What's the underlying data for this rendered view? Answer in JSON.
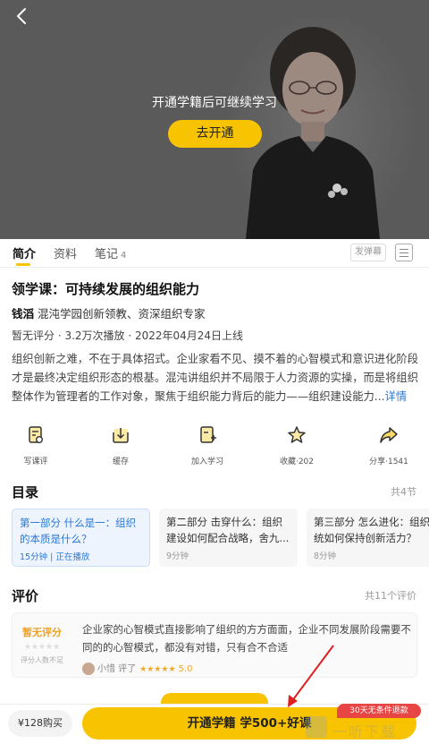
{
  "player": {
    "prompt": "开通学籍后可继续学习",
    "open_button": "去开通"
  },
  "tabs": [
    {
      "label": "简介",
      "active": true
    },
    {
      "label": "资料"
    },
    {
      "label": "笔记",
      "count": "4"
    }
  ],
  "danmu_button": "发弹幕",
  "course": {
    "title": "领学课：可持续发展的组织能力",
    "author": "钱滔",
    "author_desc": "混沌学园创新领教、资深组织专家",
    "stats": "暂无评分 · 3.2万次播放 · 2022年04月24日上线",
    "description": "组织创新之难，不在于具体招式。企业家看不见、摸不着的心智模式和意识进化阶段才是最终决定组织形态的根基。混沌讲组织并不局限于人力资源的实操，而是将组织整体作为管理者的工作对象，聚焦于组织能力背后的能力——组织建设能力...",
    "more": "详情"
  },
  "actions": [
    {
      "label": "写课评",
      "icon": "write-review-icon"
    },
    {
      "label": "缓存",
      "icon": "download-icon"
    },
    {
      "label": "加入学习",
      "icon": "add-study-icon"
    },
    {
      "label": "收藏·202",
      "icon": "star-icon"
    },
    {
      "label": "分享·1541",
      "icon": "share-icon"
    }
  ],
  "catalog": {
    "title": "目录",
    "more": "共4节",
    "items": [
      {
        "title": "第一部分 什么是一：组织的本质是什么？",
        "meta": "15分钟 | 正在播放",
        "active": true
      },
      {
        "title": "第二部分 击穿什么：组织建设如何配合战略，舍九...",
        "meta": "9分钟"
      },
      {
        "title": "第三部分 怎么进化：组织系统如何保持创新活力？",
        "meta": "8分钟"
      }
    ]
  },
  "reviews": {
    "title": "评价",
    "more": "共11个评价",
    "no_score": "暂无评分",
    "few_raters": "评分人数不足",
    "stars": "★★★★★",
    "item": {
      "text": "企业家的心智模式直接影响了组织的方方面面，企业不同发展阶段需要不同的的心智模式，都没有对错，只有合不合适",
      "reviewer": "小惜 评了",
      "stars": "★★★★★",
      "score": "5.0"
    }
  },
  "bottom": {
    "price": "¥128购买",
    "join": "开通学籍 学500+好课",
    "refund": "30天无条件退款",
    "watermark": "一听下载"
  },
  "colors": {
    "accent": "#f8c300",
    "link": "#2b78d6",
    "badge": "#e84545"
  }
}
